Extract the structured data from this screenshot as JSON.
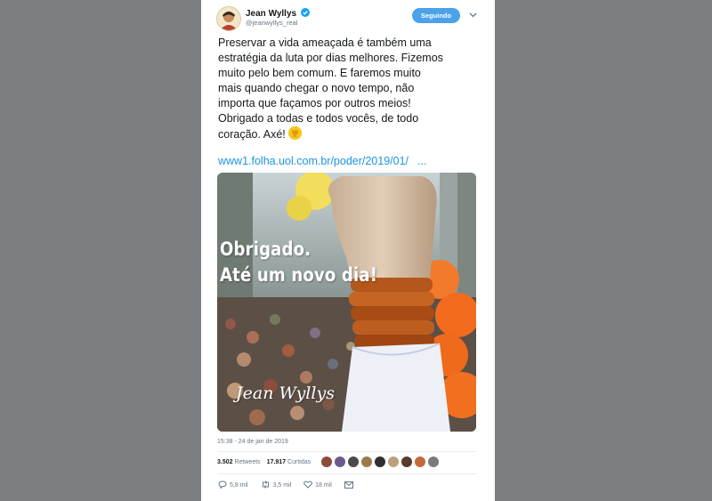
{
  "tweet": {
    "author_name": "Jean Wyllys",
    "author_handle": "@jeanwyllys_real",
    "follow_label": "Seguindo",
    "text_lines": [
      "Preservar a vida ameaçada é também uma",
      "estratégia da luta por dias melhores. Fizemos",
      "muito pelo bem comum. E faremos muito",
      "mais quando chegar o novo tempo, não",
      "importa que façamos por outros meios!",
      "Obrigado a todas e todos vocês, de todo",
      "coração. Axé!"
    ],
    "emoji": "raised-fist-emoji",
    "link_text": "www1.folha.uol.com.br/poder/2019/01/",
    "link_ellipsis": "...",
    "image": {
      "caption_line1": "Obrigado.",
      "caption_line2": "Até um novo dia!",
      "signature": "Jean Wyllys"
    },
    "timestamp": "15:38 - 24 de jan de 2019",
    "retweets_count": "3.502",
    "retweets_label": "Retweets",
    "likes_count": "17.917",
    "likes_label": "Curtidas",
    "actions": {
      "reply_count": "5,8 mil",
      "retweet_count": "3,5 mil",
      "like_count": "18 mil"
    }
  },
  "colors": {
    "page_background": "#7b7e81",
    "accent": "#1b95e0",
    "follow_button": "#4ba2e8",
    "emoji_yellow": "#f7c61b"
  }
}
